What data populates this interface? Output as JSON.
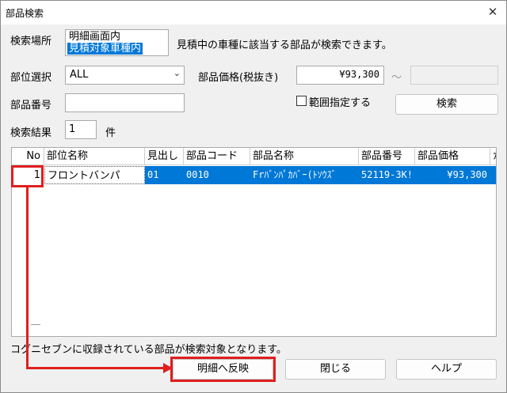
{
  "window": {
    "title": "部品検索",
    "close_glyph": "✕"
  },
  "search_location": {
    "label": "検索場所",
    "options": [
      "明細画面内",
      "見積対象車種内"
    ],
    "description": "見積中の車種に該当する部品が検索できます。"
  },
  "part_position": {
    "label": "部位選択",
    "value": "ALL"
  },
  "part_price": {
    "label": "部品価格(税抜き)",
    "value": "¥93,300",
    "range_sep": "～",
    "value_to": ""
  },
  "part_number": {
    "label": "部品番号",
    "value": ""
  },
  "range_checkbox": {
    "label": "範囲指定する",
    "checked": false
  },
  "search_button": {
    "label": "検索"
  },
  "result": {
    "label": "検索結果",
    "count": "1",
    "unit": "件"
  },
  "table": {
    "columns": [
      "No",
      "部位名称",
      "見出し",
      "部品コード",
      "部品名称",
      "部品番号",
      "部品価格",
      "か"
    ],
    "rows": [
      {
        "no": "1",
        "position_name": "フロントバンパ",
        "heading": "01",
        "part_code": "0010",
        "part_name": "Frﾊﾞﾝﾊﾟｶﾊﾞｰ(ﾄｿｳｽﾞ",
        "part_number": "52119-3K!",
        "price": "¥93,300"
      }
    ]
  },
  "footer_note": "コグニセブンに収録されている部品が検索対象となります。",
  "buttons": {
    "reflect": "明細へ反映",
    "close": "閉じる",
    "help": "ヘルプ"
  },
  "colors": {
    "selection": "#0078d7",
    "annotation": "#e01e1e"
  }
}
